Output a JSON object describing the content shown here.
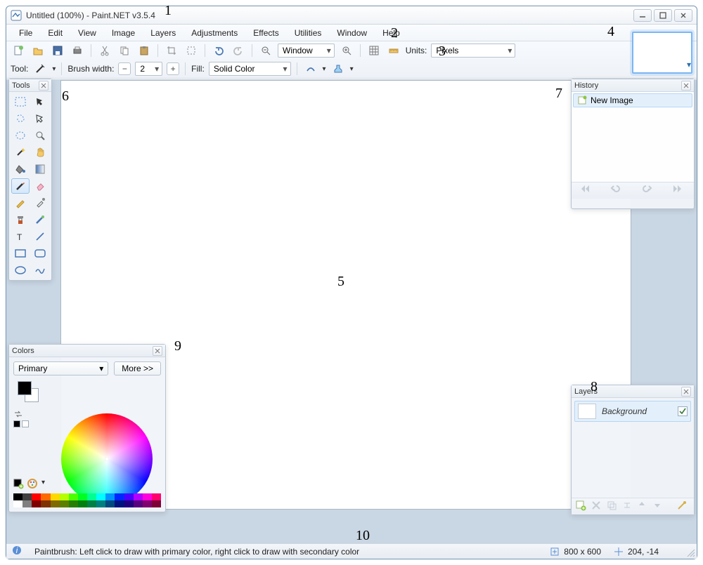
{
  "titlebar": {
    "title": "Untitled (100%) - Paint.NET v3.5.4"
  },
  "menu": {
    "items": [
      "File",
      "Edit",
      "View",
      "Image",
      "Layers",
      "Adjustments",
      "Effects",
      "Utilities",
      "Window",
      "Help"
    ]
  },
  "toolbar": {
    "zoom_mode": "Window",
    "units_label": "Units:",
    "units_value": "Pixels",
    "tool_label": "Tool:",
    "brush_width_label": "Brush width:",
    "brush_width_value": "2",
    "fill_label": "Fill:",
    "fill_value": "Solid Color"
  },
  "panels": {
    "tools": {
      "title": "Tools"
    },
    "history": {
      "title": "History",
      "items": [
        "New Image"
      ]
    },
    "layers": {
      "title": "Layers",
      "items": [
        {
          "name": "Background",
          "visible": true
        }
      ]
    },
    "colors": {
      "title": "Colors",
      "primary_label": "Primary",
      "more_label": "More >>"
    }
  },
  "status": {
    "tooltip": "Paintbrush: Left click to draw with primary color, right click to draw with secondary color",
    "dimensions": "800 x 600",
    "cursor": "204, -14"
  },
  "annotations": {
    "a1": "1",
    "a2": "2",
    "a3": "3",
    "a4": "4",
    "a5": "5",
    "a6": "6",
    "a7": "7",
    "a8": "8",
    "a9": "9",
    "a10": "10"
  }
}
